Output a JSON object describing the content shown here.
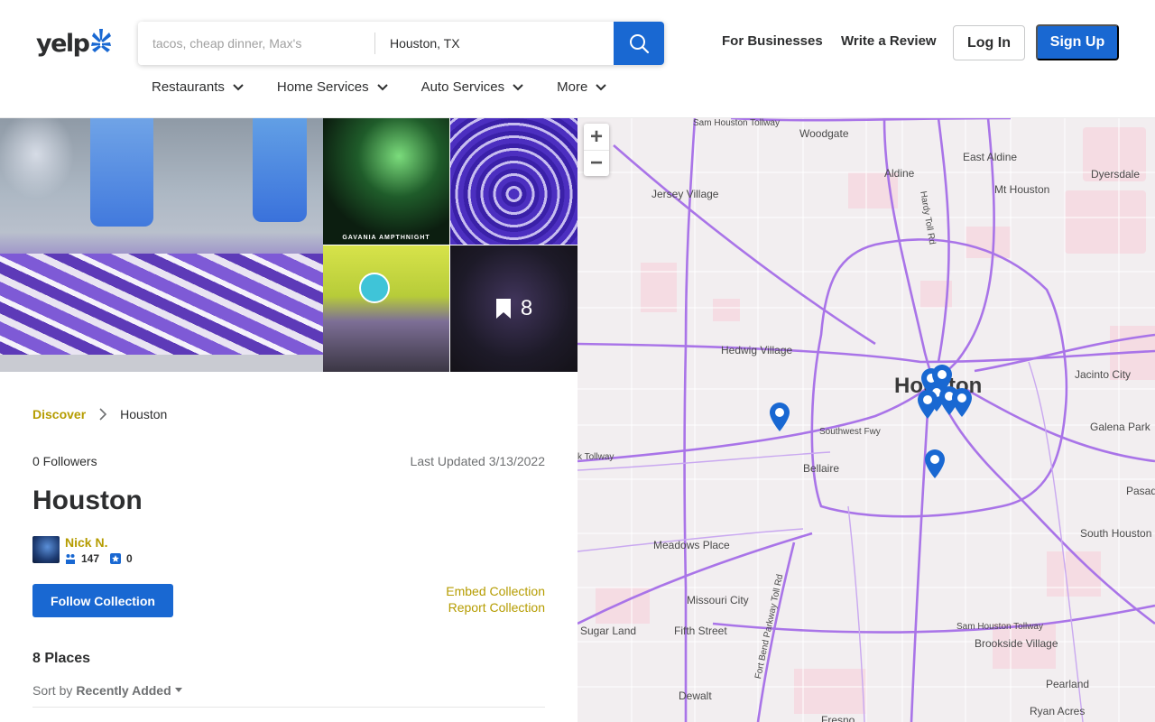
{
  "header": {
    "logo_text": "yelp",
    "search": {
      "find_placeholder": "tacos, cheap dinner, Max's",
      "near_value": "Houston, TX"
    },
    "links": {
      "for_businesses": "For Businesses",
      "write_review": "Write a Review"
    },
    "login_label": "Log In",
    "signup_label": "Sign Up",
    "categories": [
      "Restaurants",
      "Home Services",
      "Auto Services",
      "More"
    ],
    "brand_color": "#1968d2"
  },
  "collage": {
    "photo_brand_text": "GAVANIA  AMPTHNIGHT",
    "saved_count": "8"
  },
  "breadcrumb": {
    "discover": "Discover",
    "current": "Houston"
  },
  "collection": {
    "followers": "0 Followers",
    "last_updated": "Last Updated 3/13/2022",
    "title": "Houston",
    "user": {
      "name": "Nick N.",
      "friends": "147",
      "reviews": "0"
    },
    "follow_label": "Follow Collection",
    "embed_label": "Embed Collection",
    "report_label": "Report Collection",
    "places_count": "8 Places",
    "sort_label": "Sort by",
    "sort_value": "Recently Added"
  },
  "map": {
    "zoom_in": "+",
    "zoom_out": "−",
    "labels": {
      "woodgate": "Woodgate",
      "east_aldine": "East Aldine",
      "aldine": "Aldine",
      "dyersdale": "Dyersdale",
      "jersey_village": "Jersey Village",
      "mt_houston": "Mt Houston",
      "hardy_toll": "Hardy Toll Rd",
      "sam_houston_tollway": "Sam Houston Tollway",
      "hedwig": "Hedwig Village",
      "houston": "Houston",
      "jacinto_city": "Jacinto City",
      "galena_park": "Galena Park",
      "southwest_fwy": "Southwest Fwy",
      "bellaire": "Bellaire",
      "pasadena": "Pasad",
      "meadows_place": "Meadows Place",
      "south_houston": "South Houston",
      "missouri_city": "Missouri City",
      "sugar_land": "Sugar Land",
      "fifth_street": "Fifth Street",
      "fort_bend": "Fort Bend Parkway Toll Rd",
      "sam_houston_tollway_s": "Sam Houston Tollway",
      "brookside": "Brookside Village",
      "pearland": "Pearland",
      "dewalt": "Dewalt",
      "ryan_acres": "Ryan Acres",
      "fresno": "Fresno",
      "katy_tollway": "k Tollway"
    }
  }
}
